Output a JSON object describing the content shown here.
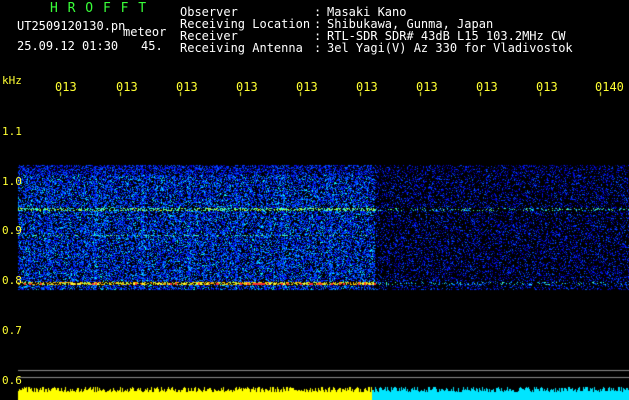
{
  "header": {
    "logo": "H R O F F T",
    "filename": "UT2509120130.pn",
    "meteor_label": "meteor",
    "datetime": "25.09.12 01:30",
    "count": "45.",
    "fields": [
      {
        "label": "Observer",
        "sep": ":",
        "value": "Masaki Kano"
      },
      {
        "label": "Receiving Location",
        "sep": ":",
        "value": "Shibukawa, Gunma, Japan"
      },
      {
        "label": "Receiver",
        "sep": ":",
        "value": "RTL-SDR SDR# 43dB L15 103.2MHz CW"
      },
      {
        "label": "Receiving Antenna",
        "sep": ":",
        "value": "3el Yagi(V) Az 330 for Vladivostok"
      }
    ]
  },
  "axis": {
    "unit": "kHz",
    "y_ticks": [
      "1.1",
      "1.0",
      "0.9",
      "0.8",
      "0.7",
      "0.6"
    ],
    "x_ticks": [
      "013",
      "013",
      "013",
      "013",
      "013",
      "013",
      "013",
      "013",
      "013",
      "0140"
    ]
  },
  "colors": {
    "label_yellow": "#ffff33",
    "logo_green": "#39ff39",
    "signal_yellow": "#ffff00",
    "signal_cyan": "#00e5ff",
    "background": "#000000"
  }
}
